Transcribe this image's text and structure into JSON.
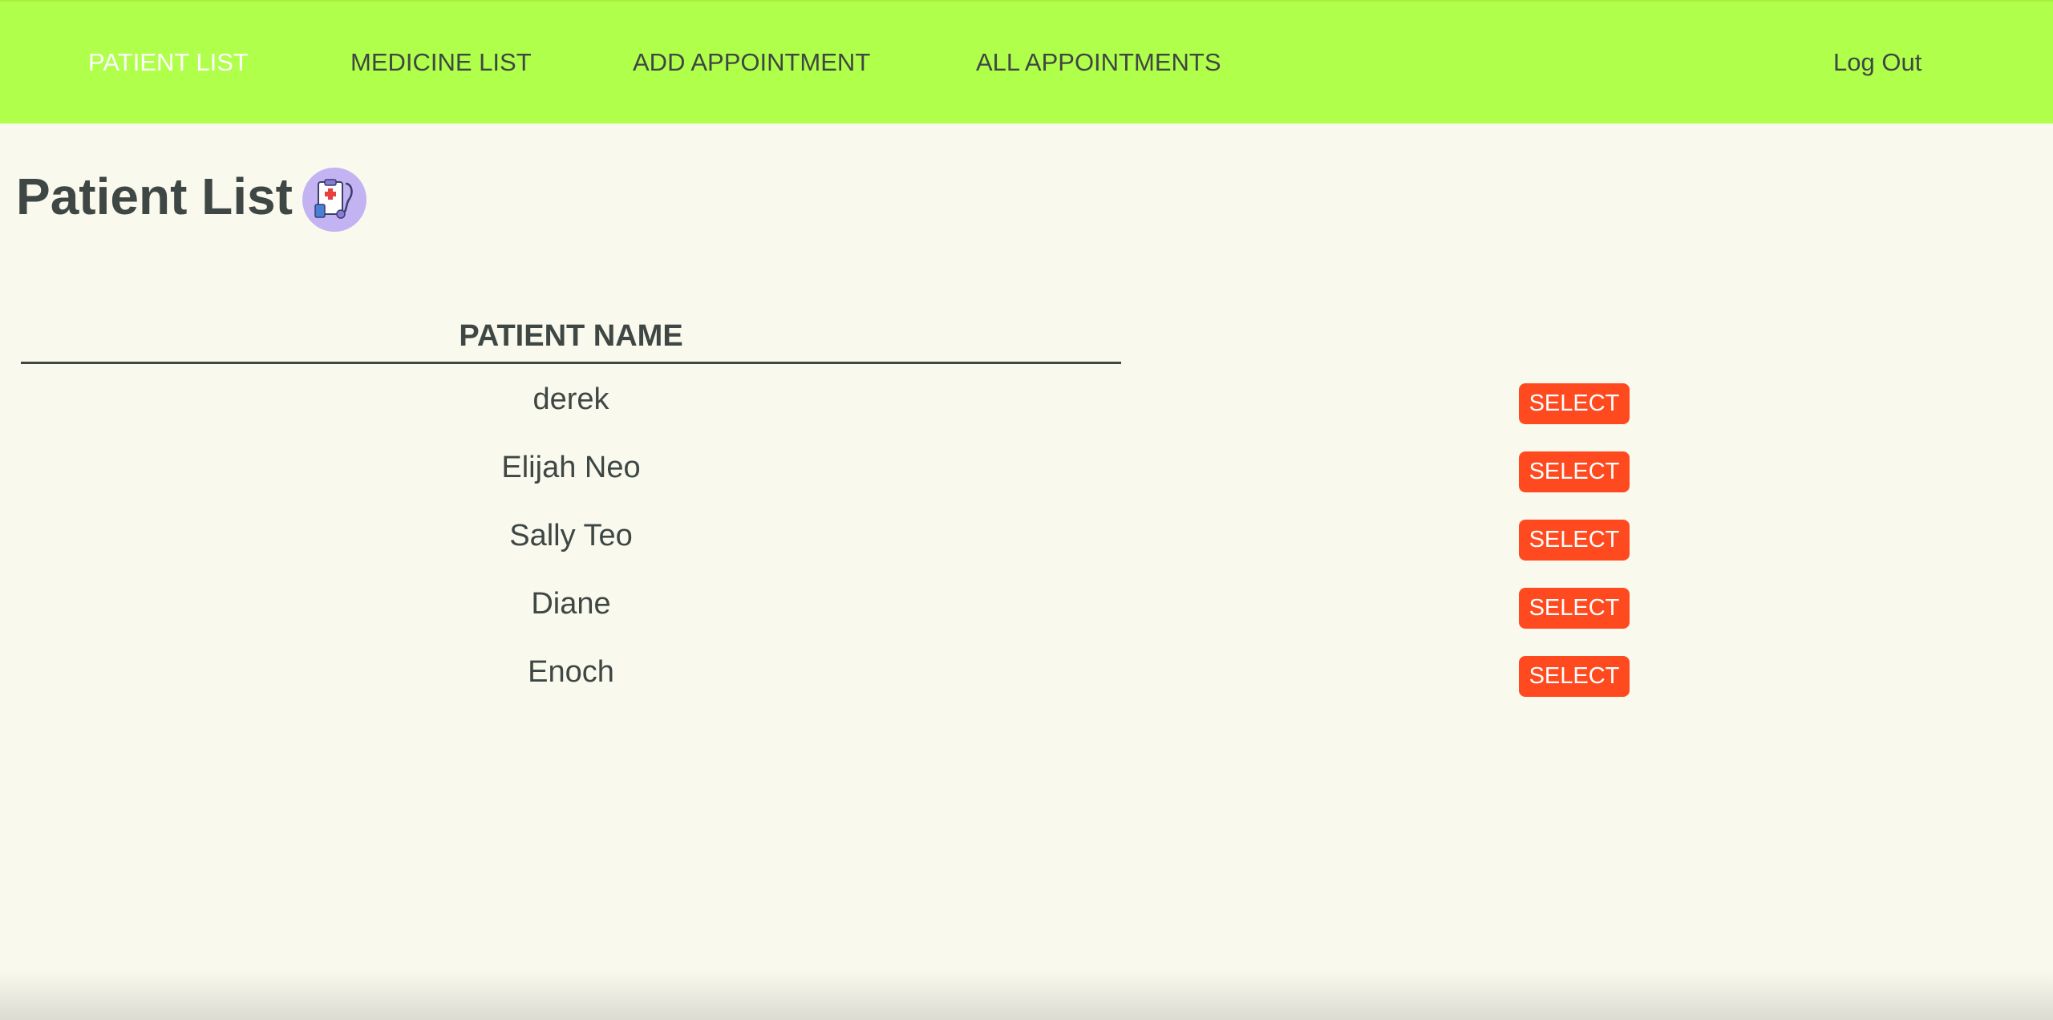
{
  "nav": {
    "items": [
      {
        "label": "PATIENT LIST",
        "active": true
      },
      {
        "label": "MEDICINE LIST",
        "active": false
      },
      {
        "label": "ADD APPOINTMENT",
        "active": false
      },
      {
        "label": "ALL APPOINTMENTS",
        "active": false
      }
    ],
    "logout_label": "Log Out"
  },
  "page": {
    "title": "Patient List",
    "title_icon": "medical-clipboard-stethoscope-icon"
  },
  "table": {
    "header": "PATIENT NAME",
    "button_label": "SELECT",
    "rows": [
      {
        "name": "derek"
      },
      {
        "name": "Elijah Neo"
      },
      {
        "name": "Sally Teo"
      },
      {
        "name": "Diane"
      },
      {
        "name": "Enoch"
      }
    ]
  },
  "colors": {
    "navbar": "#b0ff4a",
    "background": "#f9f9ee",
    "text": "#3f4744",
    "button": "#ff4a1f",
    "icon_circle": "#c3b3f2"
  }
}
